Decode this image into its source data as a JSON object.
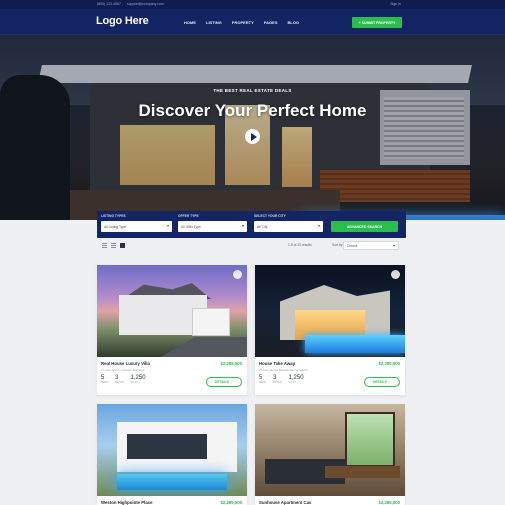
{
  "topbar": {
    "phone": "(800) 123-4567",
    "email": "support@company.com",
    "signin": "Sign In"
  },
  "nav": {
    "logo": "Logo Here",
    "items": [
      "HOME",
      "LISTING",
      "PROPERTY",
      "PAGES",
      "BLOG"
    ],
    "submit_label": "+ SUBMIT PROPERTY"
  },
  "hero": {
    "tagline": "THE BEST REAL ESTATE DEALS",
    "headline": "Discover Your Perfect Home"
  },
  "search": {
    "fields": [
      {
        "label": "LISTING TYPES",
        "value": "All Listing Type"
      },
      {
        "label": "OFFER TYPE",
        "value": "All Offer Type"
      },
      {
        "label": "SELECT YOUR CITY",
        "value": "All City"
      }
    ],
    "advanced_label": "ADVANCED SEARCH"
  },
  "toolbar": {
    "results": "1-8 of 20 results",
    "sort_label": "Sort by",
    "sort_value": "Default"
  },
  "listings": [
    {
      "title": "Real House Luxury Villa",
      "price": "$2,285,500",
      "address": "77 Ives Street, London, England",
      "beds": "5",
      "baths": "3",
      "area": "1,250",
      "beds_unit": "BEDS",
      "baths_unit": "BATHS",
      "area_unit": "SQ FT",
      "details_label": "DETAILS →"
    },
    {
      "title": "House Take Away",
      "price": "$2,285,500",
      "address": "77 Ives Street, Manchester, England",
      "beds": "5",
      "baths": "3",
      "area": "1,250",
      "beds_unit": "BEDS",
      "baths_unit": "BATHS",
      "area_unit": "SQ FT",
      "details_label": "DETAILS →"
    },
    {
      "title": "Weston Highpointe Place",
      "price": "$2,285,500"
    },
    {
      "title": "Sunhouse Apartment Cas",
      "price": "$2,285,500"
    }
  ],
  "icons": {
    "play": "play-icon",
    "favorite": "heart-icon",
    "grid_view": "grid-icon",
    "list_view": "list-icon"
  },
  "colors": {
    "brand_navy": "#132463",
    "accent_green": "#2bbd4e"
  }
}
